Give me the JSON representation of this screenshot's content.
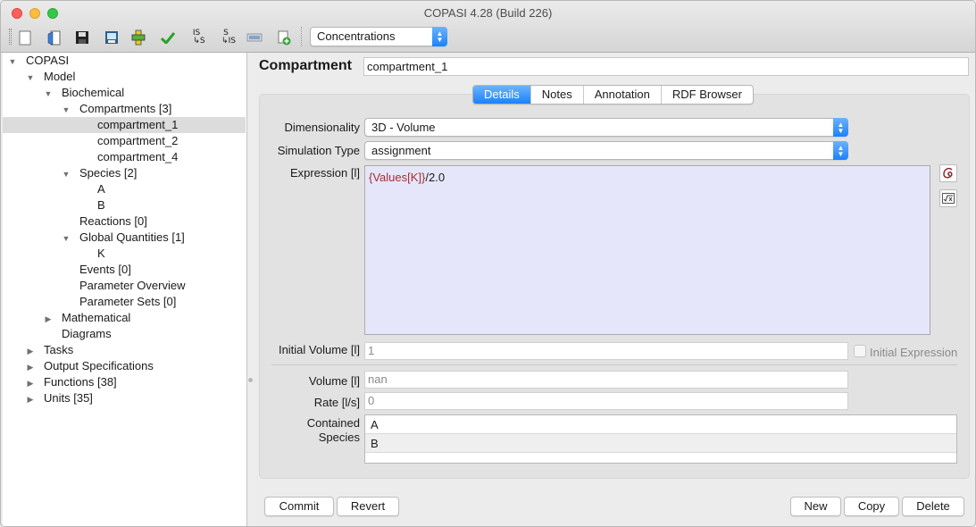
{
  "window": {
    "title": "COPASI 4.28 (Build 226)"
  },
  "toolbar": {
    "icons": [
      "new-file-icon",
      "open-file-icon",
      "save-icon",
      "save-image-icon",
      "model-check-icon",
      "check-icon",
      "is-to-s-icon",
      "s-to-is-icon",
      "sbml-icon",
      "add-icon"
    ],
    "is_s_label": "IS",
    "is_s_sub": "↳S",
    "s_is_label": "S",
    "s_is_sub": "↳IS",
    "unit_select": "Concentrations"
  },
  "tree": {
    "items": [
      {
        "label": "COPASI",
        "expanded": true
      },
      {
        "label": "Model",
        "expanded": true
      },
      {
        "label": "Biochemical",
        "expanded": true
      },
      {
        "label": "Compartments [3]",
        "expanded": true
      },
      {
        "label": "compartment_1",
        "selected": true
      },
      {
        "label": "compartment_2"
      },
      {
        "label": "compartment_4"
      },
      {
        "label": "Species [2]",
        "expanded": true
      },
      {
        "label": "A"
      },
      {
        "label": "B"
      },
      {
        "label": "Reactions [0]"
      },
      {
        "label": "Global Quantities [1]",
        "expanded": true
      },
      {
        "label": "K"
      },
      {
        "label": "Events [0]"
      },
      {
        "label": "Parameter Overview"
      },
      {
        "label": "Parameter Sets [0]"
      },
      {
        "label": "Mathematical",
        "expanded": false
      },
      {
        "label": "Diagrams"
      },
      {
        "label": "Tasks",
        "expanded": false
      },
      {
        "label": "Output Specifications",
        "expanded": false
      },
      {
        "label": "Functions [38]",
        "expanded": false
      },
      {
        "label": "Units [35]",
        "expanded": false
      }
    ]
  },
  "compartment": {
    "heading": "Compartment",
    "name": "compartment_1",
    "tabs": [
      "Details",
      "Notes",
      "Annotation",
      "RDF Browser"
    ],
    "active_tab": "Details",
    "dimensionality_label": "Dimensionality",
    "dimensionality_value": "3D - Volume",
    "simulation_type_label": "Simulation Type",
    "simulation_type_value": "assignment",
    "expression_label": "Expression [l]",
    "expression_ref": "{Values[K]}",
    "expression_rest": "/2.0",
    "initial_volume_label": "Initial Volume [l]",
    "initial_volume_value": "1",
    "initial_expression_label": "Initial Expression",
    "initial_expression_checked": false,
    "volume_label": "Volume [l]",
    "volume_value": "nan",
    "rate_label": "Rate [l/s]",
    "rate_value": "0",
    "contained_species_label_1": "Contained",
    "contained_species_label_2": "Species",
    "contained_species": [
      "A",
      "B"
    ]
  },
  "buttons": {
    "commit": "Commit",
    "revert": "Revert",
    "new": "New",
    "copy": "Copy",
    "delete": "Delete"
  }
}
